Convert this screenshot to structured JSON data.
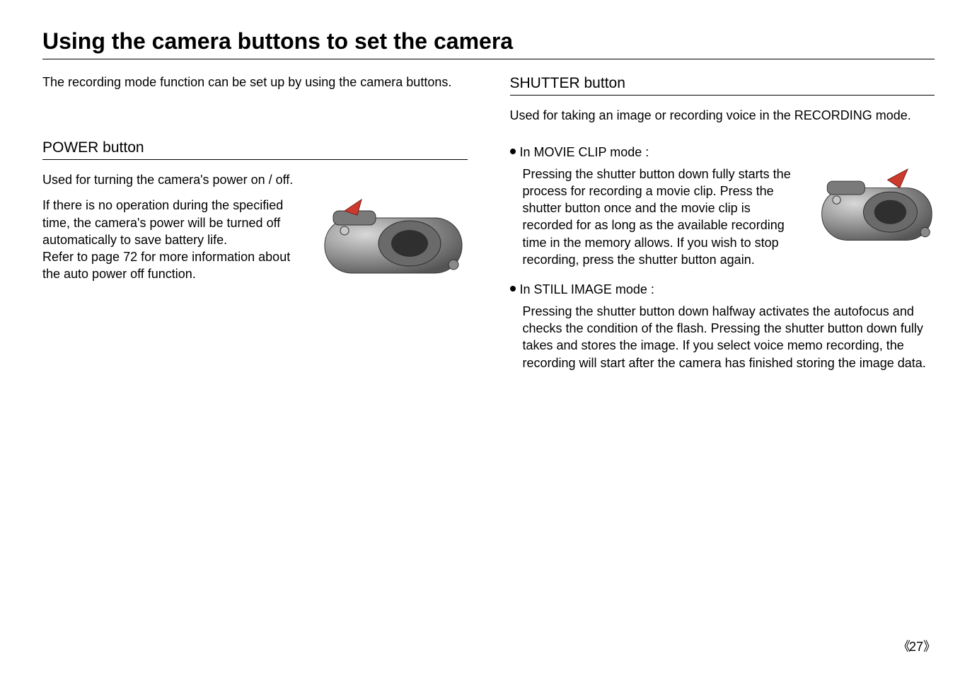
{
  "title": "Using the camera buttons to set the camera",
  "leftCol": {
    "intro": "The recording mode function can be set up by using the camera buttons.",
    "section": {
      "heading": "POWER button",
      "p1": "Used for turning the camera's power on / off.",
      "p2": "If there is no operation during the specified time, the camera's power will be turned off automatically to save battery life.",
      "p3": "Refer to page 72 for more information about the auto power off function."
    }
  },
  "rightCol": {
    "section": {
      "heading": "SHUTTER button",
      "intro": "Used for taking an image or recording voice in the RECORDING mode.",
      "bullet1": {
        "label": "In MOVIE CLIP mode :",
        "body": "Pressing the shutter button down fully starts the process for recording a movie clip. Press the shutter button once and the movie clip is recorded for as long as the available recording time in the memory allows. If you wish to stop recording, press the shutter button again."
      },
      "bullet2": {
        "label": "In STILL IMAGE mode :",
        "body": "Pressing the shutter button down halfway activates the autofocus and checks the condition of the flash. Pressing the shutter button down fully takes and stores the image. If you select voice memo recording, the recording will start after the camera has finished storing the image data."
      }
    }
  },
  "pageNumber": "27"
}
